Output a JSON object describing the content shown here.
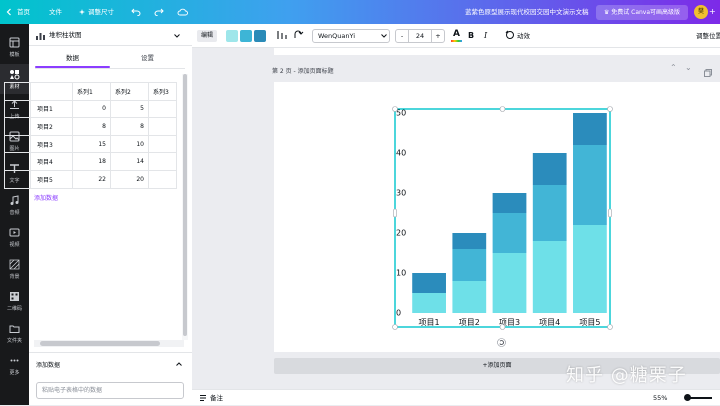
{
  "topbar": {
    "home": "首页",
    "file": "文件",
    "resize": "调整尺寸",
    "doc_title": "蓝紫色原型展示现代校园交园中文演示文稿",
    "upgrade": "免费试 Canva可画高级版",
    "avatar": "樊"
  },
  "sidebar": {
    "items": [
      {
        "label": "模板",
        "icon": "template-icon"
      },
      {
        "label": "素材",
        "icon": "elements-icon"
      },
      {
        "label": "上传",
        "icon": "upload-icon"
      },
      {
        "label": "图片",
        "icon": "photo-icon"
      },
      {
        "label": "文字",
        "icon": "text-icon"
      },
      {
        "label": "音频",
        "icon": "audio-icon"
      },
      {
        "label": "视频",
        "icon": "video-icon"
      },
      {
        "label": "背景",
        "icon": "background-icon"
      },
      {
        "label": "二维码",
        "icon": "qrcode-icon"
      },
      {
        "label": "文件夹",
        "icon": "folder-icon"
      },
      {
        "label": "更多",
        "icon": "more-icon"
      }
    ]
  },
  "panel": {
    "chart_type": "堆积柱状图",
    "tabs": [
      "数据",
      "设置"
    ],
    "table": {
      "columns": [
        "系列1",
        "系列2",
        "系列3"
      ],
      "rows": [
        {
          "label": "项目1",
          "s1": "0",
          "s2": "5"
        },
        {
          "label": "项目2",
          "s1": "8",
          "s2": "8"
        },
        {
          "label": "项目3",
          "s1": "15",
          "s2": "10"
        },
        {
          "label": "项目4",
          "s1": "18",
          "s2": "14"
        },
        {
          "label": "项目5",
          "s1": "22",
          "s2": "20"
        }
      ]
    },
    "add_data_link": "添加数据",
    "add_data_section": "添加数据",
    "paste_placeholder": "粘贴电子表格中的数据"
  },
  "toolbar": {
    "edit": "编辑",
    "swatches": [
      "#9ee6ea",
      "#3db5d6",
      "#2a8bb8"
    ],
    "font": "WenQuanYi",
    "minus": "-",
    "font_size": "24",
    "plus": "+",
    "bold": "B",
    "italic": "I",
    "animate": "动效",
    "position": "调整位置"
  },
  "canvas": {
    "page_title": "第 2 页 - 添加页面标题",
    "add_page": "+添加页面"
  },
  "statusbar": {
    "notes": "备注",
    "zoom": "55%"
  },
  "watermark": "知乎 @糖栗子",
  "chart_data": {
    "type": "bar",
    "stacked": true,
    "categories": [
      "项目1",
      "项目2",
      "项目3",
      "项目4",
      "项目5"
    ],
    "series": [
      {
        "name": "系列1",
        "values": [
          5,
          8,
          15,
          18,
          22
        ],
        "color": "#6ee0e8"
      },
      {
        "name": "系列2",
        "values": [
          0,
          8,
          10,
          14,
          20
        ],
        "color": "#42b5d6"
      },
      {
        "name": "系列3",
        "values": [
          5,
          4,
          5,
          8,
          8
        ],
        "color": "#2b8cbc"
      }
    ],
    "y_ticks": [
      "0",
      "10",
      "20",
      "30",
      "40",
      "50"
    ],
    "ylim": [
      0,
      50
    ],
    "grid": false,
    "legend": "none"
  }
}
